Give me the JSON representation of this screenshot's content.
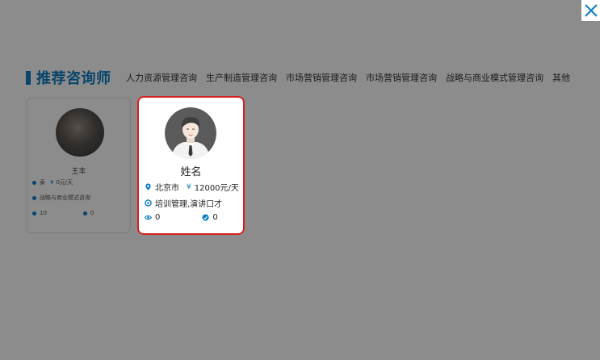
{
  "section": {
    "title": "推荐咨询师",
    "categories": [
      "人力资源管理咨询",
      "生产制造管理咨询",
      "市场营销管理咨询",
      "市场营销管理咨询",
      "战略与商业模式管理咨询",
      "其他"
    ]
  },
  "background_card": {
    "name": "王丰",
    "location": "泰",
    "rate": "0元/天",
    "expertise": "战略与商业模式咨询",
    "views": "10",
    "likes": "0"
  },
  "highlighted_card": {
    "name": "姓名",
    "location": "北京市",
    "currency_symbol": "¥",
    "rate": "12000元/天",
    "expertise": "培训管理,演讲口才",
    "views": "0",
    "likes": "0"
  },
  "colors": {
    "accent": "#0d7ec3",
    "highlight_border": "#d81e1e",
    "overlay": "rgba(0,0,0,0.45)"
  }
}
